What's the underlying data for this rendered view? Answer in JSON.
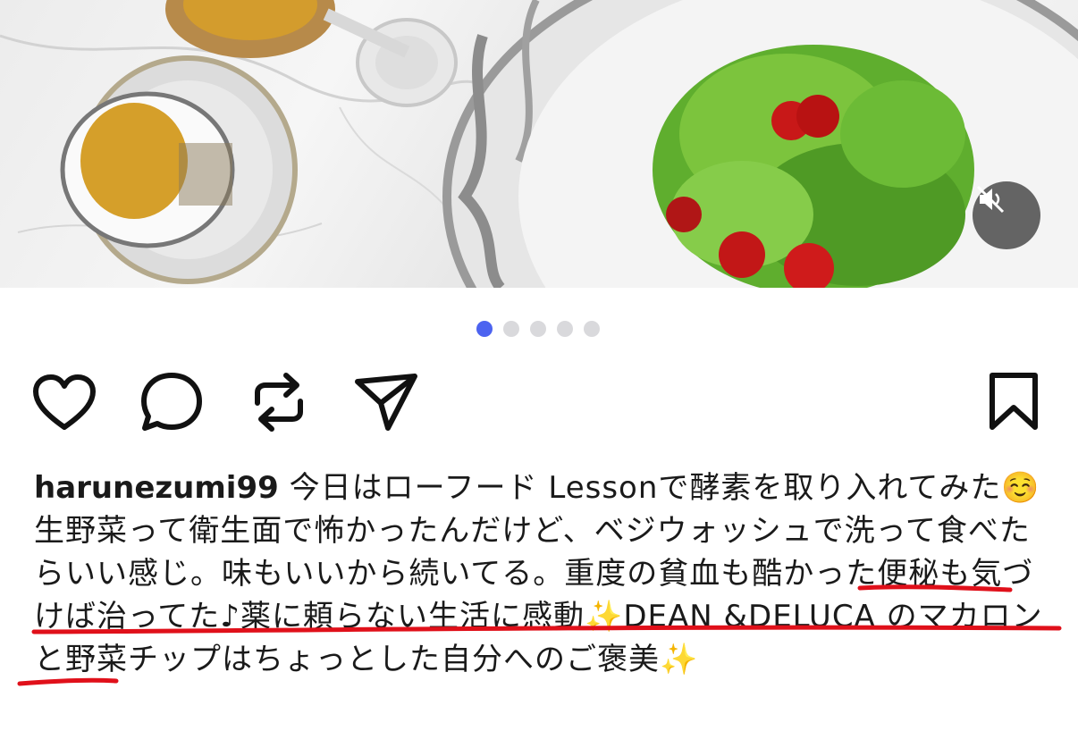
{
  "post": {
    "username": "harunezumi99",
    "caption_parts": [
      "今日はローフード Lessonで酵素を取り入れてみた",
      "☺️",
      "生野菜って衛生面で怖かったんだけど、ベジウォッシュで洗って食べたらいい感じ。味もいいから続いてる。重度の貧血も酷かった便秘も気づけば治ってた♪薬に頼らない生活に感動",
      "✨",
      "DEAN &DELUCA のマカロンと野菜チップはちょっとした自分へのご褒美",
      "✨"
    ]
  },
  "carousel": {
    "total": 5,
    "active_index": 0
  },
  "icons": {
    "like": "heart-icon",
    "comment": "comment-bubble-icon",
    "share": "repost-icon",
    "send": "paper-plane-icon",
    "save": "bookmark-icon",
    "mute": "speaker-muted-icon"
  },
  "colors": {
    "carousel_active": "#4c63f0",
    "carousel_inactive": "#d9d9dc",
    "annotation_underline": "#e0101a"
  }
}
